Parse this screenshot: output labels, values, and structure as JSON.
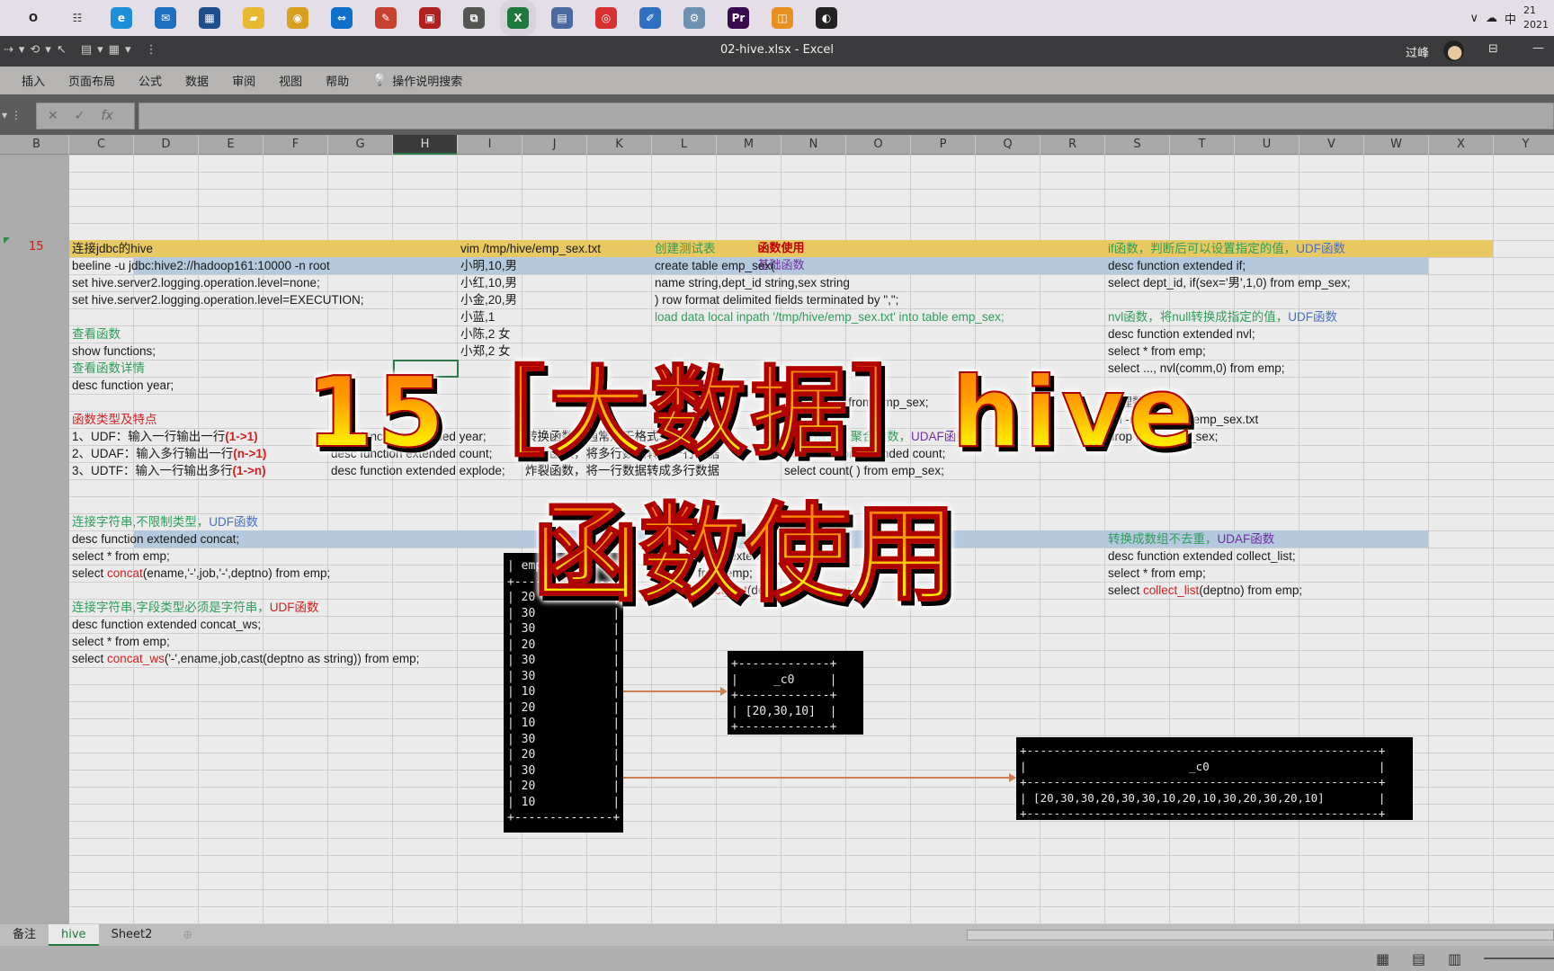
{
  "taskbar": {
    "icons": [
      {
        "name": "cortana-icon",
        "color": "#222222",
        "glyph": "O"
      },
      {
        "name": "task-view-icon",
        "color": "#333333",
        "glyph": "☷"
      },
      {
        "name": "edge-icon",
        "color": "#1d8fd8",
        "glyph": "e"
      },
      {
        "name": "mail-icon",
        "color": "#1e6fc0",
        "glyph": "✉"
      },
      {
        "name": "store-icon",
        "color": "#1f4e8c",
        "glyph": "▦"
      },
      {
        "name": "file-explorer-icon",
        "color": "#e8b830",
        "glyph": "▰"
      },
      {
        "name": "chrome-icon",
        "color": "#d8a020",
        "glyph": "◉"
      },
      {
        "name": "teamviewer-icon",
        "color": "#0e70c8",
        "glyph": "⇔"
      },
      {
        "name": "app-icon",
        "color": "#c84030",
        "glyph": "✎"
      },
      {
        "name": "pdf-icon",
        "color": "#b02020",
        "glyph": "▣"
      },
      {
        "name": "network-icon",
        "color": "#555555",
        "glyph": "⧉"
      },
      {
        "name": "excel-icon",
        "color": "#1e7a3c",
        "glyph": "X"
      },
      {
        "name": "remote-icon",
        "color": "#4a6aa0",
        "glyph": "▤"
      },
      {
        "name": "app-red-icon",
        "color": "#d83030",
        "glyph": "◎"
      },
      {
        "name": "notepad-icon",
        "color": "#3070c0",
        "glyph": "✐"
      },
      {
        "name": "settings-app-icon",
        "color": "#7090b0",
        "glyph": "⚙"
      },
      {
        "name": "premiere-icon",
        "color": "#3a0a50",
        "glyph": "Pr"
      },
      {
        "name": "app-orange-icon",
        "color": "#e89020",
        "glyph": "◫"
      },
      {
        "name": "obs-icon",
        "color": "#222222",
        "glyph": "◐"
      }
    ],
    "tray": {
      "chevron": "∨",
      "ime": "中",
      "time": "21",
      "date": "2021"
    }
  },
  "titlebar": {
    "title": "02-hive.xlsx  -  Excel",
    "user": "过峰"
  },
  "ribbon": {
    "tabs": [
      "插入",
      "页面布局",
      "公式",
      "数据",
      "审阅",
      "视图",
      "帮助"
    ],
    "search": "操作说明搜索"
  },
  "formula": {
    "cancel": "✕",
    "enter": "✓",
    "fx": "fx"
  },
  "columns": [
    "C",
    "D",
    "E",
    "F",
    "G",
    "H",
    "I",
    "J",
    "K",
    "L",
    "M",
    "N",
    "O",
    "P",
    "Q",
    "R",
    "S",
    "T",
    "U",
    "V",
    "W",
    "X",
    "Y"
  ],
  "selected_column": "H",
  "row_number": "15",
  "colors": {
    "green": "#2e9e5a",
    "blue": "#4a6fc4",
    "red": "#d42020",
    "purple": "#7030a0",
    "header_red": "#c00000",
    "yellow_band": "#e8c860",
    "blue_band": "#b4c8de"
  },
  "bands": {
    "main": "函数使用",
    "basic": "基础函数",
    "string": "字"
  },
  "cells": [
    {
      "r": 2,
      "c": "C",
      "parts": [
        [
          "连接jdbc的hive",
          ""
        ]
      ]
    },
    {
      "r": 3,
      "c": "C",
      "parts": [
        [
          "beeline -u jdbc:hive2://hadoop161:10000 -n root",
          ""
        ]
      ]
    },
    {
      "r": 4,
      "c": "C",
      "parts": [
        [
          "set hive.server2.logging.operation.level=none;",
          ""
        ]
      ]
    },
    {
      "r": 5,
      "c": "C",
      "parts": [
        [
          "set hive.server2.logging.operation.level=EXECUTION;",
          ""
        ]
      ]
    },
    {
      "r": 7,
      "c": "C",
      "parts": [
        [
          "查看函数",
          "green"
        ]
      ]
    },
    {
      "r": 8,
      "c": "C",
      "parts": [
        [
          "show functions;",
          ""
        ]
      ]
    },
    {
      "r": 9,
      "c": "C",
      "parts": [
        [
          "查看函数详情",
          "green"
        ]
      ]
    },
    {
      "r": 10,
      "c": "C",
      "parts": [
        [
          "desc function year;",
          ""
        ]
      ]
    },
    {
      "r": 12,
      "c": "C",
      "parts": [
        [
          "函数类型及特点",
          "red"
        ]
      ]
    },
    {
      "r": 13,
      "c": "C",
      "parts": [
        [
          "1、UDF：输入一行输出一行",
          ""
        ],
        [
          "(1->1)",
          "redb"
        ]
      ]
    },
    {
      "r": 14,
      "c": "C",
      "parts": [
        [
          "2、UDAF：输入多行输出一行",
          ""
        ],
        [
          "(n->1)",
          "redb"
        ]
      ]
    },
    {
      "r": 15,
      "c": "C",
      "parts": [
        [
          "3、UDTF：输入一行输出多行",
          ""
        ],
        [
          "(1->n)",
          "redb"
        ]
      ]
    },
    {
      "r": 12,
      "c": "G",
      "parts": [
        [
          "例如",
          "green"
        ]
      ]
    },
    {
      "r": 13,
      "c": "G",
      "parts": [
        [
          "desc function extended year;",
          ""
        ]
      ]
    },
    {
      "r": 14,
      "c": "G",
      "parts": [
        [
          "desc function extended count;",
          ""
        ]
      ]
    },
    {
      "r": 15,
      "c": "G",
      "parts": [
        [
          "desc function extended explode;",
          ""
        ]
      ]
    },
    {
      "r": 13,
      "c": "J",
      "parts": [
        [
          "转换函数，通常用于格式转换",
          ""
        ]
      ]
    },
    {
      "r": 14,
      "c": "J",
      "parts": [
        [
          "聚合函数，将多行数据转成一行数据",
          ""
        ]
      ]
    },
    {
      "r": 15,
      "c": "J",
      "parts": [
        [
          "炸裂函数，将一行数据转成多行数据",
          ""
        ]
      ]
    },
    {
      "r": 2,
      "c": "I",
      "parts": [
        [
          "vim /tmp/hive/emp_sex.txt",
          ""
        ]
      ]
    },
    {
      "r": 3,
      "c": "I",
      "parts": [
        [
          "小明,10,男",
          ""
        ]
      ]
    },
    {
      "r": 4,
      "c": "I",
      "parts": [
        [
          "小红,10,男",
          ""
        ]
      ]
    },
    {
      "r": 5,
      "c": "I",
      "parts": [
        [
          "小金,20,男",
          ""
        ]
      ]
    },
    {
      "r": 6,
      "c": "I",
      "parts": [
        [
          "小蓝,1",
          ""
        ]
      ]
    },
    {
      "r": 7,
      "c": "I",
      "parts": [
        [
          "小陈,2  女",
          ""
        ]
      ]
    },
    {
      "r": 8,
      "c": "I",
      "parts": [
        [
          "小郑,2  女",
          ""
        ]
      ]
    },
    {
      "r": 2,
      "c": "L",
      "parts": [
        [
          "创建测试表",
          "green"
        ]
      ]
    },
    {
      "r": 3,
      "c": "L",
      "parts": [
        [
          "create table emp_sex(",
          ""
        ]
      ]
    },
    {
      "r": 4,
      "c": "L",
      "parts": [
        [
          "name string,dept_id string,sex string",
          ""
        ]
      ]
    },
    {
      "r": 5,
      "c": "L",
      "parts": [
        [
          ") row format delimited fields terminated by \",\";",
          ""
        ]
      ]
    },
    {
      "r": 6,
      "c": "L",
      "parts": [
        [
          "load data local inpath '/tmp/hive/emp_sex.txt' into table emp_sex;",
          "green"
        ]
      ]
    },
    {
      "r": 11,
      "c": "N",
      "parts": [
        [
          "else '0' end from emp_sex;",
          ""
        ]
      ]
    },
    {
      "r": 13,
      "c": "N",
      "parts": [
        [
          "count函数，聚合函数，",
          "green"
        ],
        [
          "UDAF函数",
          "purple"
        ]
      ]
    },
    {
      "r": 14,
      "c": "N",
      "parts": [
        [
          "desc function extended count;",
          ""
        ]
      ]
    },
    {
      "r": 15,
      "c": "N",
      "parts": [
        [
          "select count(   ) from emp_sex;",
          ""
        ]
      ]
    },
    {
      "r": 2,
      "c": "S",
      "parts": [
        [
          "if函数，判断后可以设置指定的值，",
          "green"
        ],
        [
          "UDF函数",
          "blue"
        ]
      ]
    },
    {
      "r": 3,
      "c": "S",
      "parts": [
        [
          "desc function extended if;",
          ""
        ]
      ]
    },
    {
      "r": 4,
      "c": "S",
      "parts": [
        [
          "select dept_id, if(sex='男',1,0) from emp_sex;",
          ""
        ]
      ]
    },
    {
      "r": 6,
      "c": "S",
      "parts": [
        [
          "nvl函数，将null转换成指定的值，",
          "green"
        ],
        [
          "UDF函数",
          "blue"
        ]
      ]
    },
    {
      "r": 7,
      "c": "S",
      "parts": [
        [
          "desc function extended nvl;",
          ""
        ]
      ]
    },
    {
      "r": 8,
      "c": "S",
      "parts": [
        [
          "select * from emp;",
          ""
        ]
      ]
    },
    {
      "r": 9,
      "c": "S",
      "parts": [
        [
          "select ..., nvl(comm,0) from emp;",
          ""
        ]
      ]
    },
    {
      "r": 11,
      "c": "S",
      "parts": [
        [
          "清理数据",
          ""
        ]
      ]
    },
    {
      "r": 12,
      "c": "S",
      "parts": [
        [
          "rm -rf /tmp/hive/emp_sex.txt",
          ""
        ]
      ]
    },
    {
      "r": 13,
      "c": "S",
      "parts": [
        [
          "drop table emp_sex;",
          ""
        ]
      ]
    },
    {
      "r": 18,
      "c": "C",
      "parts": [
        [
          "连接字符串,不限制类型，",
          "green"
        ],
        [
          "UDF函数",
          "blue"
        ]
      ]
    },
    {
      "r": 19,
      "c": "C",
      "parts": [
        [
          "desc function extended concat;",
          ""
        ]
      ]
    },
    {
      "r": 20,
      "c": "C",
      "parts": [
        [
          "select * from emp;",
          ""
        ]
      ]
    },
    {
      "r": 21,
      "c": "C",
      "parts": [
        [
          "select ",
          ""
        ],
        [
          "concat",
          "red"
        ],
        [
          "(ename,'-',job,'-',deptno) from emp;",
          ""
        ]
      ]
    },
    {
      "r": 23,
      "c": "C",
      "parts": [
        [
          "连接字符串,字段类型必须是字符串，",
          "green"
        ],
        [
          "UDF函数",
          "red"
        ]
      ]
    },
    {
      "r": 24,
      "c": "C",
      "parts": [
        [
          "desc function extended concat_ws;",
          ""
        ]
      ]
    },
    {
      "r": 25,
      "c": "C",
      "parts": [
        [
          "select * from emp;",
          ""
        ]
      ]
    },
    {
      "r": 26,
      "c": "C",
      "parts": [
        [
          "select ",
          ""
        ],
        [
          "concat_ws",
          "red"
        ],
        [
          "('-',ename,job,cast(deptno as string)) from emp;",
          ""
        ]
      ]
    },
    {
      "r": 19,
      "c": "L",
      "parts": [
        [
          "转换成数组并去重      数组，",
          "green"
        ],
        [
          "UDAF函数",
          "purple"
        ]
      ]
    },
    {
      "r": 20,
      "c": "L",
      "parts": [
        [
          "desc function extended collect_set;",
          ""
        ]
      ]
    },
    {
      "r": 21,
      "c": "L",
      "parts": [
        [
          "select * from emp;",
          ""
        ]
      ]
    },
    {
      "r": 22,
      "c": "L",
      "parts": [
        [
          "select ",
          ""
        ],
        [
          "collect_set",
          "red"
        ],
        [
          "(deptno) from emp;",
          ""
        ]
      ]
    },
    {
      "r": 19,
      "c": "S",
      "parts": [
        [
          "转换成数组不去重，",
          "green"
        ],
        [
          "UDAF函数",
          "purple"
        ]
      ]
    },
    {
      "r": 20,
      "c": "S",
      "parts": [
        [
          "desc function extended collect_list;",
          ""
        ]
      ]
    },
    {
      "r": 21,
      "c": "S",
      "parts": [
        [
          "select * from emp;",
          ""
        ]
      ]
    },
    {
      "r": 22,
      "c": "S",
      "parts": [
        [
          "select ",
          ""
        ],
        [
          "collect_list",
          "red"
        ],
        [
          "(deptno) from emp;",
          ""
        ]
      ]
    }
  ],
  "terminals": {
    "emp": {
      "header": "| emp",
      "values": [
        "20",
        "30",
        "30",
        "20",
        "30",
        "30",
        "10",
        "20",
        "10",
        "30",
        "20",
        "30",
        "20",
        "10"
      ]
    },
    "set_result": {
      "text": "+-------------+\n|     _c0     |\n+-------------+\n| [20,30,10]  |\n+-------------+"
    },
    "list_result": {
      "text": "+----------------------------------------------------+\n|                        _c0                         |\n+----------------------------------------------------+\n| [20,30,30,20,30,30,10,20,10,30,20,30,20,10]        |\n+----------------------------------------------------+"
    }
  },
  "overlay": {
    "line1": "15［大数据］hive",
    "line2": "函数使用"
  },
  "sheets": [
    "备注",
    "hive",
    "Sheet2"
  ],
  "active_sheet": "hive"
}
